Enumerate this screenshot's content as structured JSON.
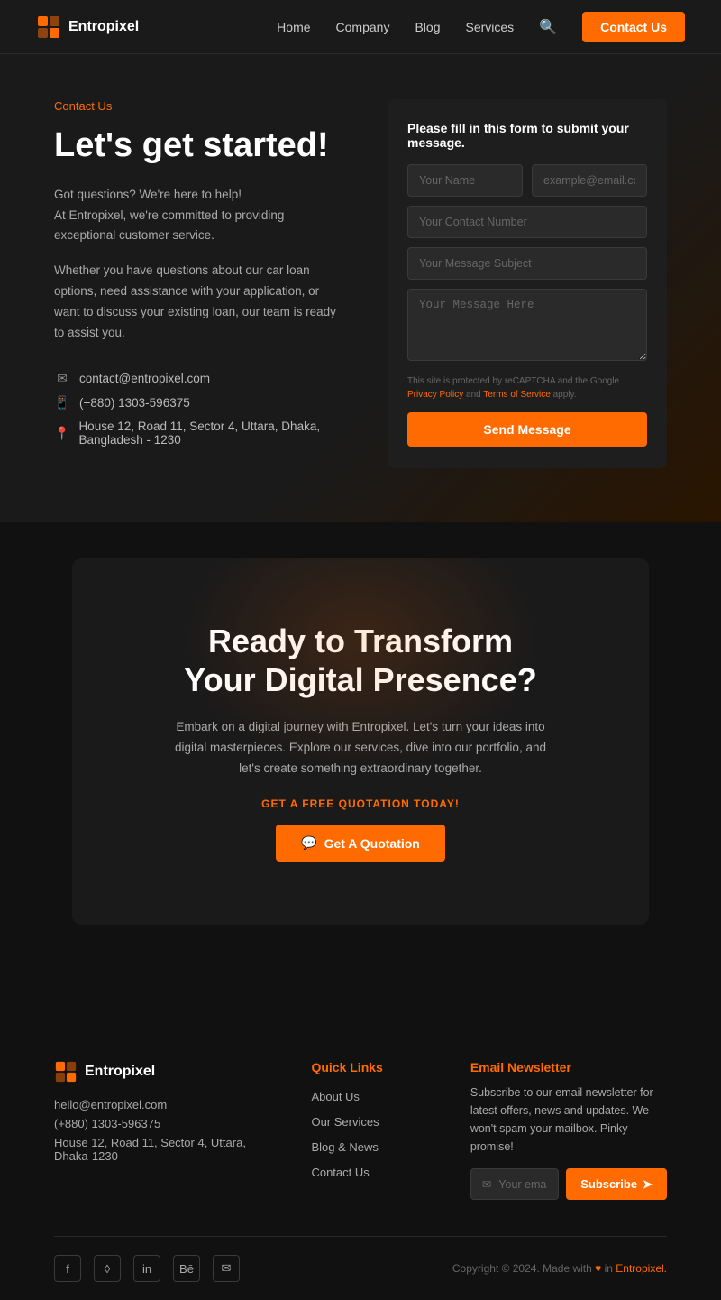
{
  "brand": {
    "name": "Entropixel"
  },
  "navbar": {
    "links": [
      {
        "label": "Home",
        "href": "#"
      },
      {
        "label": "Company",
        "href": "#"
      },
      {
        "label": "Blog",
        "href": "#"
      },
      {
        "label": "Services",
        "href": "#"
      }
    ],
    "cta_label": "Contact Us"
  },
  "contact": {
    "breadcrumb_home": "Contact",
    "breadcrumb_sep": " Us",
    "title": "Let's get started!",
    "desc1": "Got questions? We're here to help!\nAt Entropixel, we're committed to providing exceptional customer service.",
    "desc2": "Whether you have questions about our car loan options, need assistance with your application, or want to discuss your existing loan, our team is ready to assist you.",
    "email": "contact@entropixel.com",
    "phone": "(+880) 1303-596375",
    "address": "House 12, Road 11, Sector 4, Uttara, Dhaka, Bangladesh - 1230"
  },
  "form": {
    "title": "Please fill in this form to submit your message.",
    "name_placeholder": "Your Name",
    "email_placeholder": "example@email.com",
    "phone_placeholder": "Your Contact Number",
    "subject_placeholder": "Your Message Subject",
    "message_placeholder": "Your Message Here",
    "recaptcha_text": "This site is protected by reCAPTCHA and the Google ",
    "privacy_label": "Privacy Policy",
    "and": " and ",
    "terms_label": "Terms of Service",
    "recaptcha_end": " apply.",
    "submit_label": "Send Message"
  },
  "cta": {
    "title_line1": "Ready to Transform",
    "title_line2": "Your Digital Presence?",
    "desc": "Embark on a digital journey with Entropixel. Let's turn your ideas into digital masterpieces. Explore our services, dive into our portfolio, and let's create something extraordinary together.",
    "free_label": "GET A FREE QUOTATION TODAY!",
    "button_label": "Get A Quotation"
  },
  "footer": {
    "brand_name": "Entropixel",
    "email": "hello@entropixel.com",
    "phone": "(+880) 1303-596375",
    "address": "House 12, Road 11, Sector 4, Uttara, Dhaka-1230",
    "quick_links_title": "Quick Links",
    "quick_links": [
      {
        "label": "About Us"
      },
      {
        "label": "Our Services"
      },
      {
        "label": "Blog & News"
      },
      {
        "label": "Contact Us"
      }
    ],
    "newsletter_title": "Email Newsletter",
    "newsletter_desc": "Subscribe to our email newsletter for latest offers, news and updates. We won't spam your mailbox. Pinky promise!",
    "email_input_placeholder": "Your email",
    "subscribe_label": "Subscribe",
    "copyright": "Copyright © 2024. Made with ❤ in Entropixel.",
    "social_icons": [
      "facebook",
      "instagram",
      "linkedin",
      "behance",
      "email"
    ]
  }
}
